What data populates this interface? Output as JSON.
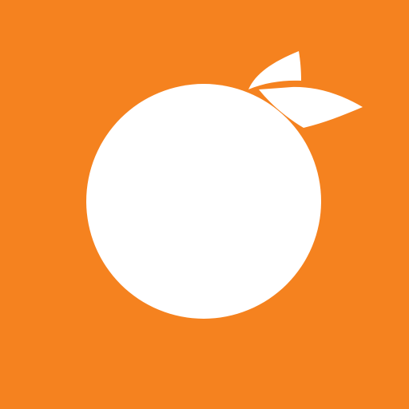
{
  "logo": {
    "icon": "orange-fruit-icon",
    "background_color": "#F5821F",
    "fruit_color": "#FFFFFF",
    "leaf_color": "#FFFFFF"
  }
}
